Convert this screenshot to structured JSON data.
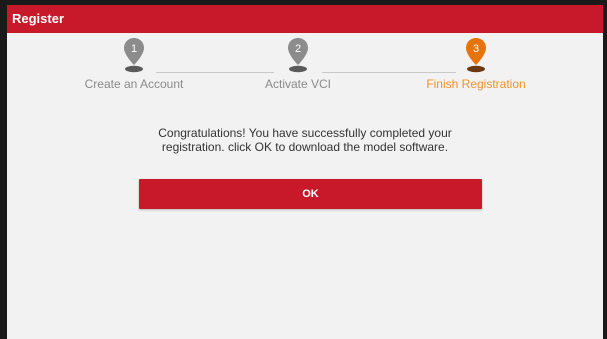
{
  "header": {
    "title": "Register"
  },
  "stepper": {
    "steps": [
      {
        "number": "1",
        "label": "Create an Account",
        "state": "inactive"
      },
      {
        "number": "2",
        "label": "Activate VCI",
        "state": "inactive"
      },
      {
        "number": "3",
        "label": "Finish Registration",
        "state": "active"
      }
    ]
  },
  "message": {
    "line1": "Congratulations! You have successfully completed your",
    "line2": "registration. click OK to download the model software."
  },
  "actions": {
    "ok_label": "OK"
  },
  "colors": {
    "brand_red": "#c8192b",
    "active_orange": "#e8730c",
    "inactive_gray": "#8c8c8c"
  }
}
